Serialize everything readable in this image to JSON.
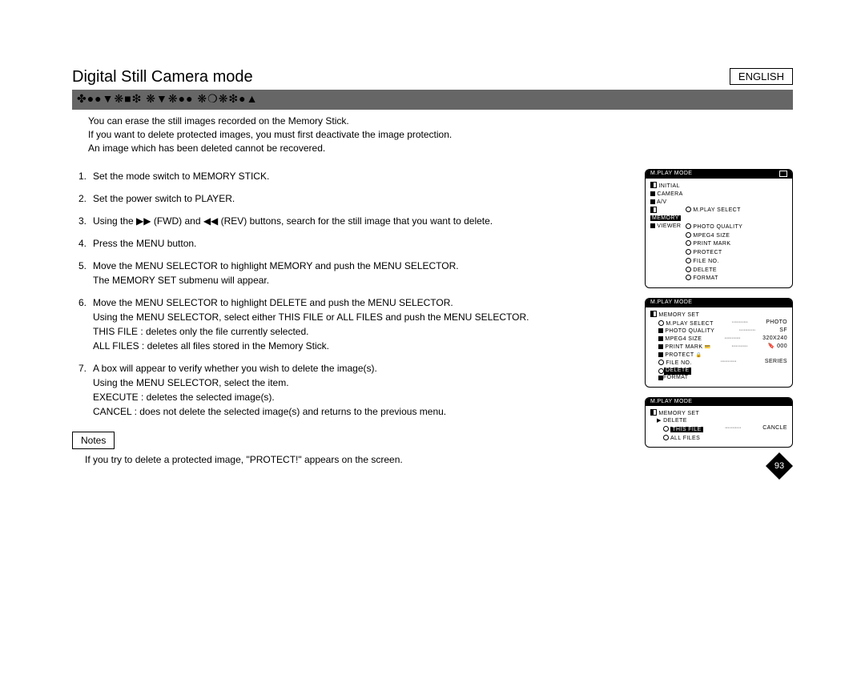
{
  "language": "ENGLISH",
  "title": "Digital Still Camera mode",
  "section_header": "✤●●▼❋■❇ ❋▼❋●● ❋❍❋❇●▲",
  "intro": [
    "You can erase the still images recorded on the Memory Stick.",
    "If you want to delete protected images, you must first deactivate the image protection.",
    "An image which has been deleted cannot be recovered."
  ],
  "steps": [
    {
      "n": "1.",
      "lines": [
        "Set the mode switch to MEMORY STICK."
      ]
    },
    {
      "n": "2.",
      "lines": [
        "Set the power switch to PLAYER."
      ]
    },
    {
      "n": "3.",
      "lines": [
        "Using the  ▶▶ (FWD) and  ◀◀ (REV) buttons, search for the still image that you want to delete."
      ]
    },
    {
      "n": "4.",
      "lines": [
        "Press the MENU button."
      ]
    },
    {
      "n": "5.",
      "lines": [
        "Move the MENU SELECTOR to highlight MEMORY and push the MENU SELECTOR.",
        "The MEMORY SET submenu will appear."
      ]
    },
    {
      "n": "6.",
      "lines": [
        "Move the MENU SELECTOR to highlight DELETE and push the MENU SELECTOR.",
        "Using the MENU SELECTOR, select either THIS FILE or ALL FILES and push the MENU SELECTOR.",
        "THIS FILE : deletes only the file currently selected.",
        "ALL FILES : deletes all files stored in the Memory Stick."
      ]
    },
    {
      "n": "7.",
      "lines": [
        "A box will appear to verify whether you wish to delete the image(s).",
        "Using the MENU SELECTOR, select the item.",
        "EXECUTE : deletes the selected image(s).",
        "CANCEL : does not delete the selected image(s) and returns to the previous menu."
      ]
    }
  ],
  "notes_label": "Notes",
  "notes_text": "If you try to delete a protected image, \"PROTECT!\" appears on the screen.",
  "page_number": "93",
  "screen1": {
    "title": "M.PLAY  MODE",
    "left": [
      "INITIAL",
      "CAMERA",
      "A/V",
      "MEMORY",
      "VIEWER"
    ],
    "right": [
      "M.PLAY SELECT",
      "PHOTO QUALITY",
      "MPEG4 SIZE",
      "PRINT MARK",
      "PROTECT",
      "FILE NO.",
      "DELETE",
      "FORMAT"
    ]
  },
  "screen2": {
    "title": "M.PLAY  MODE",
    "sub": "MEMORY SET",
    "rows": [
      {
        "l": "M.PLAY  SELECT",
        "r": "PHOTO"
      },
      {
        "l": "PHOTO QUALITY",
        "r": "SF"
      },
      {
        "l": "MPEG4 SIZE",
        "r": "320X240"
      },
      {
        "l": "PRINT MARK",
        "r": "000",
        "icon": "tag"
      },
      {
        "l": "PROTECT",
        "r": "",
        "icon": "lock"
      },
      {
        "l": "FILE NO.",
        "r": "SERIES"
      },
      {
        "l": "DELETE",
        "hl": true
      },
      {
        "l": "FORMAT"
      }
    ]
  },
  "screen3": {
    "title": "M.PLAY  MODE",
    "sub": "MEMORY SET",
    "del": "DELETE",
    "opts": [
      {
        "l": "THIS FILE",
        "r": "CANCLE",
        "hl": true
      },
      {
        "l": "ALL FILES"
      }
    ]
  }
}
